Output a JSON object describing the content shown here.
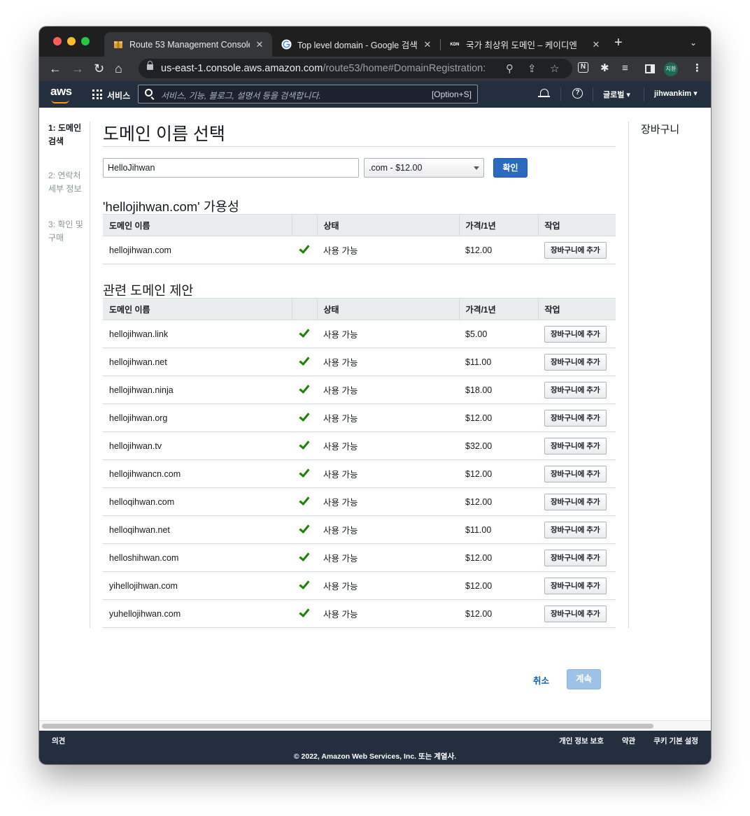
{
  "browser": {
    "tabs": [
      {
        "title": "Route 53 Management Console",
        "favicon": "aws-box-icon",
        "active": true
      },
      {
        "title": "Top level domain - Google 검색",
        "favicon": "google-g-icon",
        "active": false
      },
      {
        "title": "국가 최상위 도메인 – 케이디엔",
        "favicon_text": "KDN",
        "active": false
      }
    ],
    "url_host": "us-east-1.console.aws.amazon.com",
    "url_path": "/route53/home#DomainRegistration:",
    "profile_label": "지환"
  },
  "aws_nav": {
    "logo": "aws",
    "services_label": "서비스",
    "search_placeholder": "서비스, 기능, 블로그, 설명서 등을 검색합니다.",
    "search_shortcut": "[Option+S]",
    "region_label": "글로벌",
    "user_label": "jihwankim"
  },
  "steps": [
    {
      "label": "1: 도메인 검색",
      "active": true
    },
    {
      "label": "2: 연락처 세부 정보",
      "active": false
    },
    {
      "label": "3: 확인 및 구매",
      "active": false
    }
  ],
  "page_title": "도메인 이름 선택",
  "search_form": {
    "domain_value": "HelloJihwan",
    "tld_selected": ".com - $12.00",
    "confirm_label": "확인"
  },
  "availability": {
    "title": "'hellojihwan.com' 가용성",
    "columns": [
      "도메인 이름",
      "상태",
      "가격/1년",
      "작업"
    ],
    "rows": [
      {
        "domain": "hellojihwan.com",
        "status": "사용 가능",
        "price": "$12.00",
        "action": "장바구니에 추가"
      }
    ]
  },
  "suggestions": {
    "title": "관련 도메인 제안",
    "columns": [
      "도메인 이름",
      "상태",
      "가격/1년",
      "작업"
    ],
    "rows": [
      {
        "domain": "hellojihwan.link",
        "status": "사용 가능",
        "price": "$5.00",
        "action": "장바구니에 추가"
      },
      {
        "domain": "hellojihwan.net",
        "status": "사용 가능",
        "price": "$11.00",
        "action": "장바구니에 추가"
      },
      {
        "domain": "hellojihwan.ninja",
        "status": "사용 가능",
        "price": "$18.00",
        "action": "장바구니에 추가"
      },
      {
        "domain": "hellojihwan.org",
        "status": "사용 가능",
        "price": "$12.00",
        "action": "장바구니에 추가"
      },
      {
        "domain": "hellojihwan.tv",
        "status": "사용 가능",
        "price": "$32.00",
        "action": "장바구니에 추가"
      },
      {
        "domain": "hellojihwancn.com",
        "status": "사용 가능",
        "price": "$12.00",
        "action": "장바구니에 추가"
      },
      {
        "domain": "helloqihwan.com",
        "status": "사용 가능",
        "price": "$12.00",
        "action": "장바구니에 추가"
      },
      {
        "domain": "helloqihwan.net",
        "status": "사용 가능",
        "price": "$11.00",
        "action": "장바구니에 추가"
      },
      {
        "domain": "helloshihwan.com",
        "status": "사용 가능",
        "price": "$12.00",
        "action": "장바구니에 추가"
      },
      {
        "domain": "yihellojihwan.com",
        "status": "사용 가능",
        "price": "$12.00",
        "action": "장바구니에 추가"
      },
      {
        "domain": "yuhellojihwan.com",
        "status": "사용 가능",
        "price": "$12.00",
        "action": "장바구니에 추가"
      }
    ]
  },
  "cart_title": "장바구니",
  "actions": {
    "cancel_label": "취소",
    "continue_label": "계속"
  },
  "footer": {
    "feedback": "의견",
    "links": [
      "개인 정보 보호",
      "약관",
      "쿠키 기본 설정"
    ],
    "copyright": "© 2022, Amazon Web Services, Inc. 또는 계열사."
  },
  "colors": {
    "aws_nav_bg": "#232f3e",
    "primary_button": "#2a6bbf",
    "check_green": "#1d8102",
    "aws_orange": "#ff9900"
  }
}
